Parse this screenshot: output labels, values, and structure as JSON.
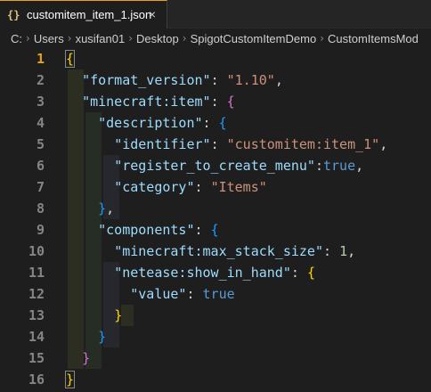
{
  "tab": {
    "icon": "{}",
    "title": "customitem_item_1.json",
    "close": "×"
  },
  "breadcrumb": [
    "C:",
    "Users",
    "xusifan01",
    "Desktop",
    "SpigotCustomItemDemo",
    "CustomItemsMod"
  ],
  "editor": {
    "active_line": 1,
    "line_numbers": [
      "1",
      "2",
      "3",
      "4",
      "5",
      "6",
      "7",
      "8",
      "9",
      "10",
      "11",
      "12",
      "13",
      "14",
      "15",
      "16"
    ],
    "tokens": {
      "open": "{",
      "close": "}",
      "colon": ": ",
      "comma": ",",
      "format_key": "\"format_version\"",
      "format_val": "\"1.10\"",
      "item_key": "\"minecraft:item\"",
      "desc_key": "\"description\"",
      "identifier_key": "\"identifier\"",
      "identifier_val": "\"customitem:item_1\"",
      "register_key": "\"register_to_create_menu\"",
      "register_colon": ":",
      "register_val": "true",
      "category_key": "\"category\"",
      "category_val": "\"Items\"",
      "components_key": "\"components\"",
      "stack_key": "\"minecraft:max_stack_size\"",
      "stack_val": "1",
      "show_key": "\"netease:show_in_hand\"",
      "value_key": "\"value\"",
      "value_val": "true"
    }
  },
  "colors": {
    "tab_border": "#e8a317",
    "key": "#9cdcfe",
    "string": "#ce9178",
    "number": "#b5cea8",
    "boolean": "#569cd6",
    "bracket_l1": "#ffd700",
    "bracket_l2": "#da70d6",
    "bracket_l3": "#179fff"
  },
  "icons": {
    "tab": "json-braces-icon",
    "close": "close-icon",
    "separator": "chevron-right-icon"
  }
}
